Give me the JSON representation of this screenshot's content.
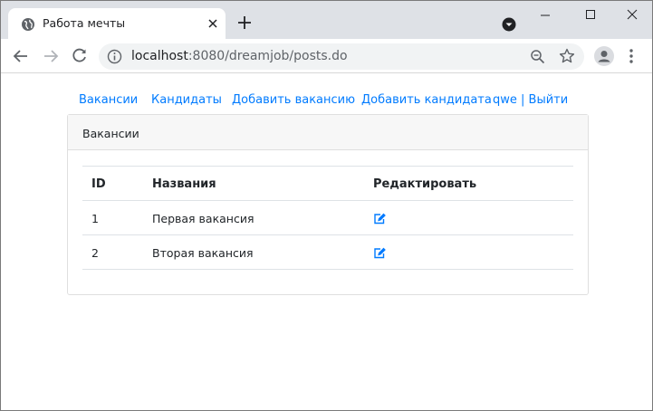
{
  "browser": {
    "tab": {
      "title": "Работа мечты",
      "favicon": "globe-icon"
    },
    "omnibox": {
      "host": "localhost",
      "path": ":8080/dreamjob/posts.do"
    }
  },
  "nav": {
    "links": [
      "Вакансии",
      "Кандидаты",
      "Добавить вакансию",
      "Добавить кандидата",
      "qwe | Выйти"
    ]
  },
  "card": {
    "header": "Вакансии",
    "table": {
      "columns": [
        "ID",
        "Названия",
        "Редактировать"
      ],
      "rows": [
        {
          "id": "1",
          "name": "Первая вакансия",
          "edit_icon": "edit-icon"
        },
        {
          "id": "2",
          "name": "Вторая вакансия",
          "edit_icon": "edit-icon"
        }
      ]
    }
  },
  "colors": {
    "link": "#007bff",
    "tabstrip": "#dee1e6",
    "card_header": "#f7f7f7"
  }
}
